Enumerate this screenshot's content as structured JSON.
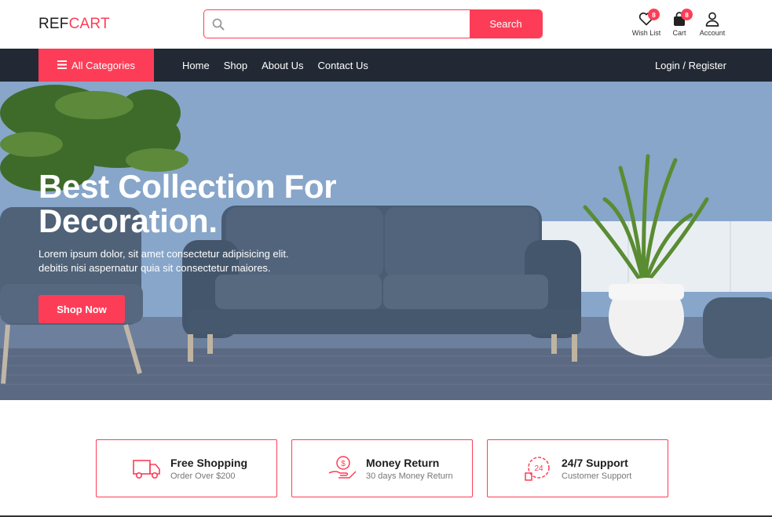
{
  "header": {
    "logo_part1": "REF",
    "logo_part2": "CART",
    "search": {
      "placeholder": "",
      "value": "",
      "button_label": "Search",
      "icon": "search-icon"
    },
    "icons": [
      {
        "name": "wishlist",
        "icon": "heart-icon",
        "label": "Wish List",
        "badge": "8"
      },
      {
        "name": "cart",
        "icon": "shopping-bag-icon",
        "label": "Cart",
        "badge": "8"
      },
      {
        "name": "account",
        "icon": "user-icon",
        "label": "Account"
      }
    ]
  },
  "nav": {
    "categories_label": "All Categories",
    "categories_icon": "bars-icon",
    "links": [
      "Home",
      "Shop",
      "About Us",
      "Contact Us"
    ],
    "login_label": "Login / Register"
  },
  "hero": {
    "title_line1": "Best Collection For",
    "title_line2": "Decoration.",
    "subtitle_line1": "Lorem ipsum dolor, sit amet consectetur adipisicing elit.",
    "subtitle_line2": "debitis nisi aspernatur quia sit consectetur maiores.",
    "cta_label": "Shop Now"
  },
  "features": [
    {
      "icon": "delivery-truck-icon",
      "title": "Free Shopping",
      "subtitle": "Order Over $200"
    },
    {
      "icon": "money-return-icon",
      "title": "Money Return",
      "subtitle": "30 days Money Return"
    },
    {
      "icon": "support-24-icon",
      "title": "24/7 Support",
      "subtitle": "Customer Support"
    }
  ],
  "colors": {
    "accent": "#fd3d57",
    "nav_bg": "#222935",
    "text_dark": "#1e1e1e"
  }
}
